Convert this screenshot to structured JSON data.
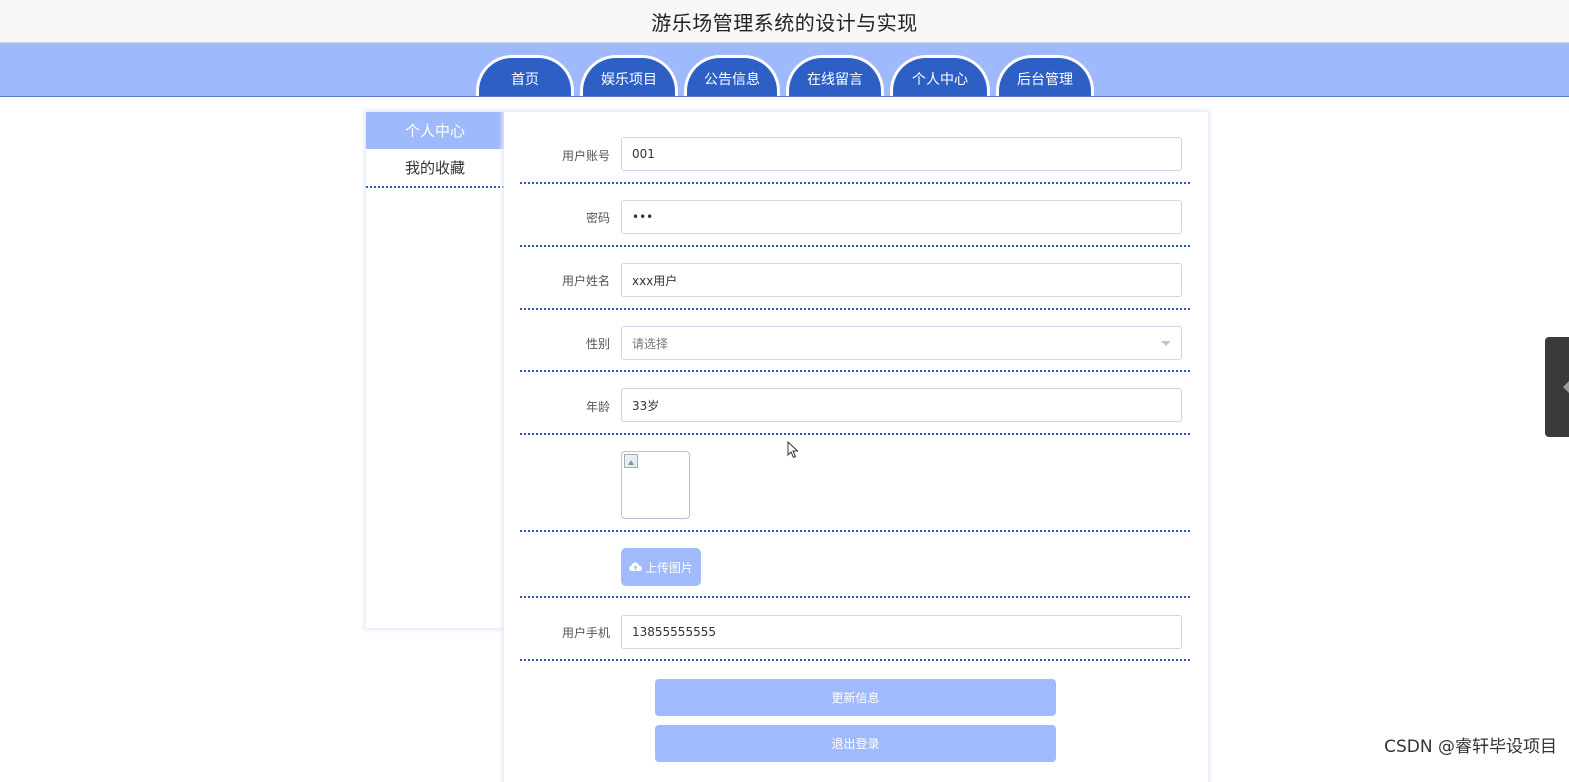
{
  "app": {
    "title": "游乐场管理系统的设计与实现"
  },
  "nav": {
    "tabs": [
      {
        "label": "首页"
      },
      {
        "label": "娱乐项目"
      },
      {
        "label": "公告信息"
      },
      {
        "label": "在线留言"
      },
      {
        "label": "个人中心"
      },
      {
        "label": "后台管理"
      }
    ]
  },
  "sidebar": {
    "items": [
      {
        "label": "个人中心",
        "active": true
      },
      {
        "label": "我的收藏",
        "active": false
      }
    ]
  },
  "form": {
    "account": {
      "label": "用户账号",
      "value": "001"
    },
    "password": {
      "label": "密码",
      "value": "•••"
    },
    "name": {
      "label": "用户姓名",
      "value": "xxx用户"
    },
    "gender": {
      "label": "性别",
      "placeholder": "请选择"
    },
    "age": {
      "label": "年龄",
      "value": "33岁"
    },
    "upload_label": "上传图片",
    "phone": {
      "label": "用户手机",
      "value": "13855555555"
    }
  },
  "actions": {
    "update_label": "更新信息",
    "logout_label": "退出登录"
  },
  "watermark": "CSDN @睿轩毕设项目",
  "colors": {
    "nav_bg": "#9fbafc",
    "tab_bg": "#2d5fc4",
    "button_bg": "#a0bafc",
    "divider": "#2a58b8"
  },
  "icons": {
    "upload": "cloud-upload-icon",
    "select_caret": "caret-down-icon",
    "side_toggle": "chevron-left-icon"
  }
}
